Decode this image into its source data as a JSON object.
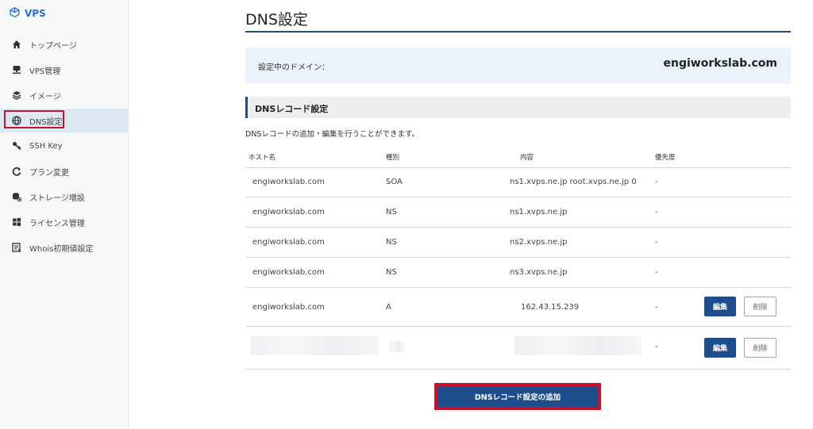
{
  "sidebar": {
    "brand": "VPS",
    "items": [
      {
        "label": "トップページ",
        "icon": "home-icon"
      },
      {
        "label": "VPS管理",
        "icon": "server-icon"
      },
      {
        "label": "イメージ",
        "icon": "layers-icon"
      },
      {
        "label": "DNS設定",
        "icon": "globe-icon",
        "active": true
      },
      {
        "label": "SSH Key",
        "icon": "key-icon"
      },
      {
        "label": "プラン変更",
        "icon": "refresh-icon"
      },
      {
        "label": "ストレージ増設",
        "icon": "storage-icon"
      },
      {
        "label": "ライセンス管理",
        "icon": "windows-icon"
      },
      {
        "label": "Whois初期値設定",
        "icon": "document-icon"
      }
    ]
  },
  "main": {
    "title": "DNS設定",
    "domain_label": "設定中のドメイン：",
    "domain_value": "engiworkslab.com",
    "section_title": "DNSレコード設定",
    "description": "DNSレコードの追加・編集を行うことができます。",
    "columns": [
      "ホスト名",
      "種別",
      "内容",
      "優先度"
    ],
    "rows": [
      {
        "host": "engiworkslab.com",
        "type": "SOA",
        "content": "ns1.xvps.ne.jp root.xvps.ne.jp 0",
        "priority": "-"
      },
      {
        "host": "engiworkslab.com",
        "type": "NS",
        "content": "ns1.xvps.ne.jp",
        "priority": "-"
      },
      {
        "host": "engiworkslab.com",
        "type": "NS",
        "content": "ns2.xvps.ne.jp",
        "priority": "-"
      },
      {
        "host": "engiworkslab.com",
        "type": "NS",
        "content": "ns3.xvps.ne.jp",
        "priority": "-"
      },
      {
        "host": "engiworkslab.com",
        "type": "A",
        "content": "162.43.15.239",
        "priority": "-",
        "edit": "編集",
        "delete": "削除"
      },
      {
        "host": "",
        "type": "",
        "content": "",
        "priority": "-",
        "edit": "編集",
        "delete": "削除",
        "blurred": true
      }
    ],
    "add_button": "DNSレコード設定の追加"
  },
  "colors": {
    "accent": "#1e4d8c",
    "highlight": "#c8102e",
    "brand": "#2a6fd1"
  }
}
